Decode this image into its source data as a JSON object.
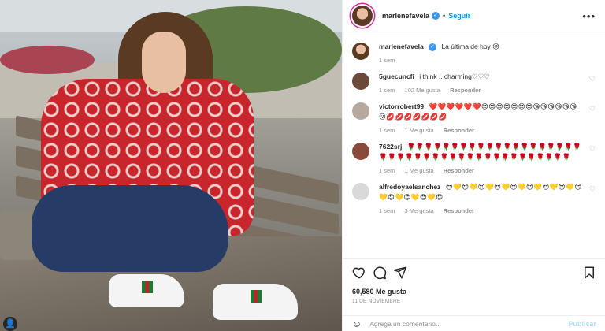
{
  "header": {
    "username": "marlenefavela",
    "verified_mark": "✓",
    "separator": "•",
    "follow_label": "Seguir",
    "more_label": "•••"
  },
  "caption": {
    "username": "marlenefavela",
    "text": "La última de hoy 😜",
    "time": "1 sem"
  },
  "comments": [
    {
      "username": "5guecuncfi",
      "text": "i think .. charming♡♡♡",
      "time": "1 sem",
      "likes": "102 Me gusta",
      "reply": "Responder",
      "avatar_color": "#6b4a3a"
    },
    {
      "username": "victorrobert99",
      "text": "❤️❤️❤️❤️❤️❤️😍😍😍😍😍😍😍😘😘😘😘😘😘😘💋💋💋💋💋💋💋",
      "time": "1 sem",
      "likes": "1 Me gusta",
      "reply": "Responder",
      "avatar_color": "#b7a9a0"
    },
    {
      "username": "7622srj",
      "text": "🌹🌹🌹🌹🌹🌹🌹🌹🌹🌹🌹🌹🌹🌹🌹🌹🌹🌹🌹🌹🌹🌹🌹🌹🌹🌹🌹🌹🌹🌹🌹🌹🌹🌹🌹🌹🌹🌹🌹🌹🌹🌹",
      "time": "1 sem",
      "likes": "1 Me gusta",
      "reply": "Responder",
      "avatar_color": "#8a4a3a"
    },
    {
      "username": "alfredoyaelsanchez",
      "text": "😍💛😍💛😍💛😍💛😍💛😍💛😍💛😍💛😍💛😍💛😍💛😍💛😍",
      "time": "1 sem",
      "likes": "3 Me gusta",
      "reply": "Responder",
      "avatar_color": "#d9d9d9"
    }
  ],
  "actions": {
    "likes": "60,580 Me gusta",
    "date": "11 DE NOVIEMBRE"
  },
  "add_comment": {
    "placeholder": "Agrega un comentario...",
    "publish_label": "Publicar"
  },
  "photo": {
    "tag_label": "👤"
  },
  "colors": {
    "accent": "#0095f6",
    "verified": "#3897f0",
    "muted": "#8e8e8e",
    "publish_disabled": "#b2dffc",
    "jacket": "#c8252d"
  }
}
